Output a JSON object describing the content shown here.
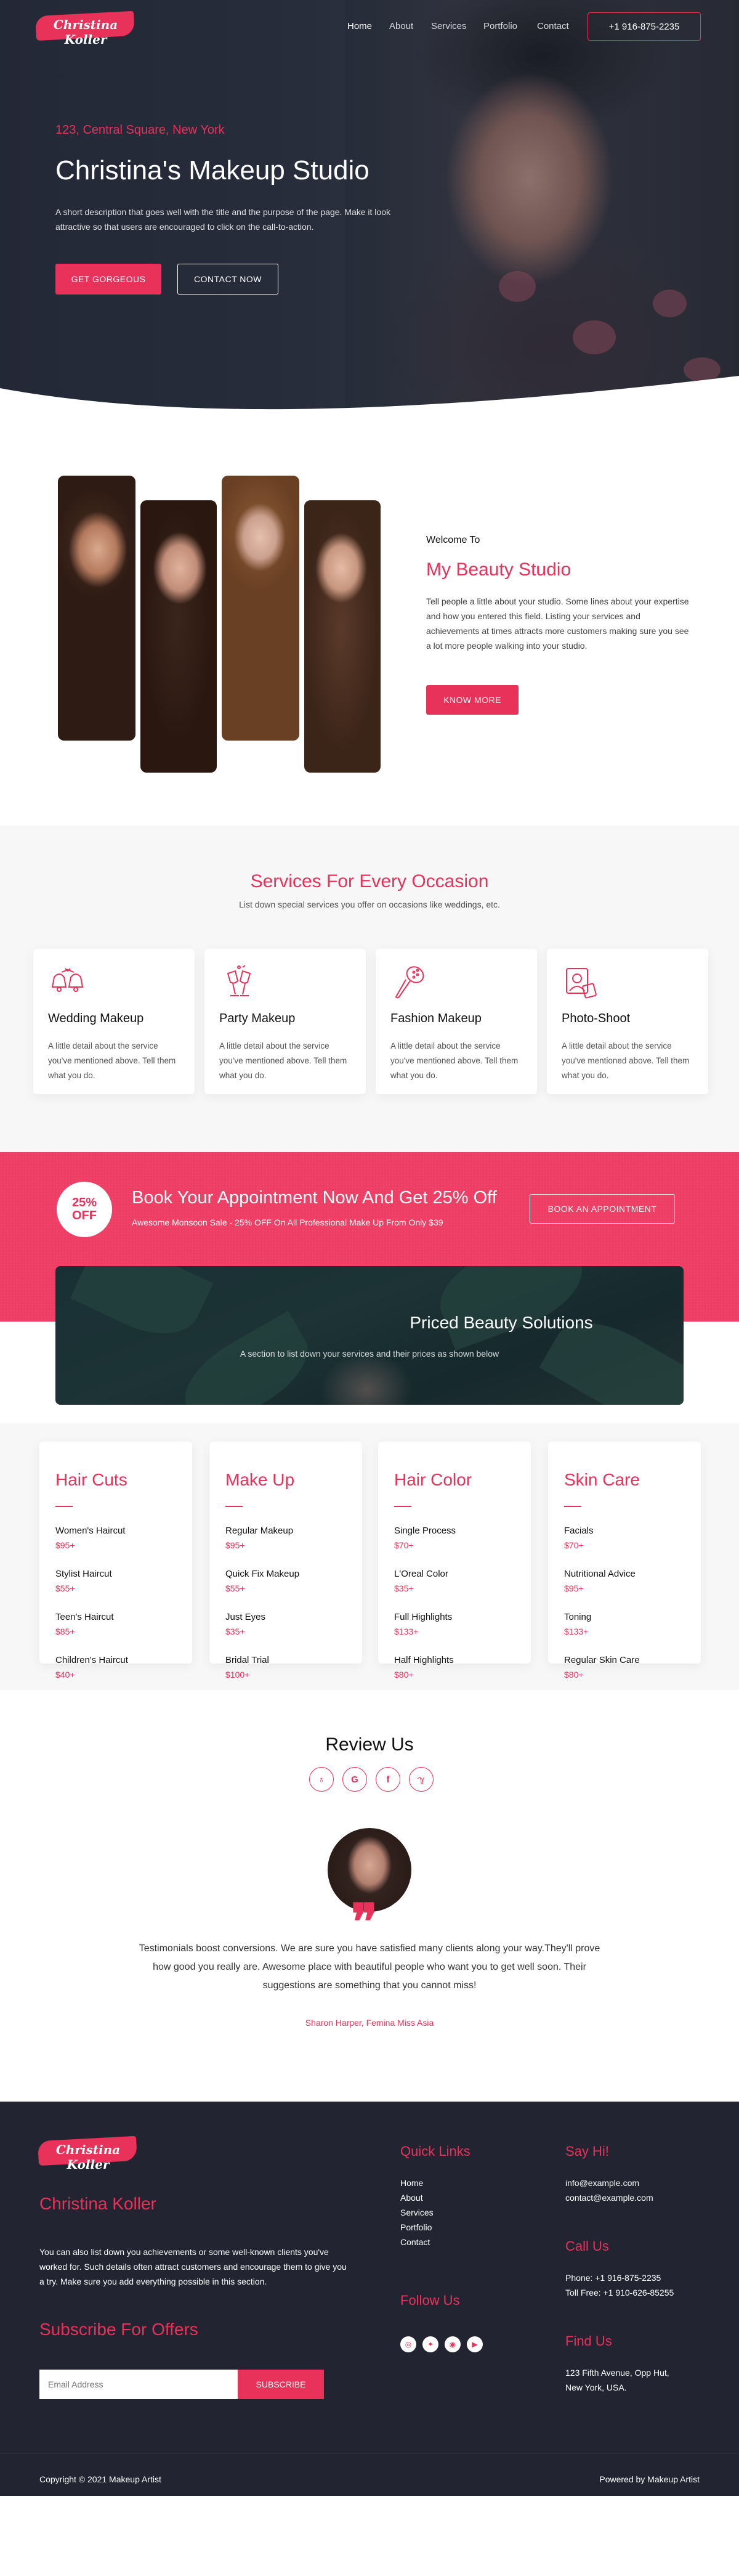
{
  "brand": {
    "name": "Christina Koller",
    "accent": "#e8325a",
    "dark": "#222431"
  },
  "nav": {
    "items": [
      "Home",
      "About",
      "Services",
      "Portfolio",
      "Contact"
    ],
    "phone": "+1 916-875-2235"
  },
  "hero": {
    "address": "123, Central Square, New York",
    "title": "Christina's Makeup Studio",
    "description": "A short description that goes well with the title and the purpose of the page. Make it look attractive so that users are encouraged to click on the call-to-action.",
    "primary_button": "GET GORGEOUS",
    "secondary_button": "CONTACT NOW"
  },
  "about": {
    "welcome": "Welcome To",
    "title": "My Beauty Studio",
    "text": "Tell people a little about your studio. Some lines about your expertise and how you entered this field. Listing your services and achievements at times attracts more customers making sure you see a lot more people walking into your studio.",
    "button": "KNOW MORE"
  },
  "services": {
    "title": "Services For Every Occasion",
    "subtitle": "List down special services you offer on occasions like weddings, etc.",
    "cards": [
      {
        "icon": "wedding-bells-icon",
        "title": "Wedding Makeup",
        "text": "A little detail about the service you've mentioned above. Tell them what you do."
      },
      {
        "icon": "champagne-glasses-icon",
        "title": "Party Makeup",
        "text": "A little detail about the service you've mentioned above. Tell them what you do."
      },
      {
        "icon": "hairbrush-icon",
        "title": "Fashion Makeup",
        "text": "A little detail about the service you've mentioned above. Tell them what you do."
      },
      {
        "icon": "photo-portrait-icon",
        "title": "Photo-Shoot",
        "text": "A little detail about the service you've mentioned above. Tell them what you do."
      }
    ]
  },
  "booking": {
    "badge_top": "25%",
    "badge_bottom": "OFF",
    "title": "Book Your Appointment Now And Get 25% Off",
    "offer": "Awesome Monsoon Sale - 25% OFF On All Professional Make Up From Only $39",
    "button": "BOOK AN APPOINTMENT"
  },
  "pricing": {
    "title": "Priced Beauty Solutions",
    "subtitle": "A section to list down your services and their prices as shown below",
    "categories": [
      {
        "title": "Hair Cuts",
        "items": [
          {
            "name": "Women's Haircut",
            "price": "$95+"
          },
          {
            "name": "Stylist Haircut",
            "price": "$55+"
          },
          {
            "name": "Teen's Haircut",
            "price": "$85+"
          },
          {
            "name": "Children's Haircut",
            "price": "$40+"
          }
        ]
      },
      {
        "title": "Make Up",
        "items": [
          {
            "name": "Regular Makeup",
            "price": "$95+"
          },
          {
            "name": "Quick Fix Makeup",
            "price": "$55+"
          },
          {
            "name": "Just Eyes",
            "price": "$35+"
          },
          {
            "name": "Bridal Trial",
            "price": "$100+"
          }
        ]
      },
      {
        "title": "Hair Color",
        "items": [
          {
            "name": "Single Process",
            "price": "$70+"
          },
          {
            "name": "L'Oreal Color",
            "price": "$35+"
          },
          {
            "name": "Full Highlights",
            "price": "$133+"
          },
          {
            "name": "Half Highlights",
            "price": "$80+"
          }
        ]
      },
      {
        "title": "Skin Care",
        "items": [
          {
            "name": "Facials",
            "price": "$70+"
          },
          {
            "name": "Nutritional Advice",
            "price": "$95+"
          },
          {
            "name": "Toning",
            "price": "$133+"
          },
          {
            "name": "Regular Skin Care",
            "price": "$80+"
          }
        ]
      }
    ]
  },
  "review": {
    "title": "Review Us",
    "icons": [
      "tripadvisor-icon",
      "google-icon",
      "facebook-icon",
      "yelp-icon"
    ],
    "icon_glyphs": [
      "♁",
      "G",
      "f",
      "ℽ"
    ],
    "quote_mark": "❞",
    "text": "Testimonials boost conversions. We are sure you have satisfied many clients along your way.They'll prove how good you really are. Awesome place with beautiful people who want you to get well soon. Their suggestions are something that you cannot miss!",
    "author": "Sharon Harper, Femina Miss Asia"
  },
  "footer": {
    "name": "Christina Koller",
    "about": "You can also list down you achievements or some well-known clients you've worked for. Such details often attract customers and encourage them to give you a try. Make sure you add everything possible in this section.",
    "subscribe_title": "Subscribe For Offers",
    "email_placeholder": "Email Address",
    "subscribe_button": "SUBSCRIBE",
    "quick_links_title": "Quick Links",
    "quick_links": [
      "Home",
      "About",
      "Services",
      "Portfolio",
      "Contact"
    ],
    "follow_title": "Follow Us",
    "follow_icons": [
      "instagram-icon",
      "twitter-icon",
      "instagram-alt-icon",
      "youtube-icon"
    ],
    "follow_glyphs": [
      "◎",
      "✦",
      "◉",
      "▶"
    ],
    "say_hi_title": "Say Hi!",
    "emails": [
      "info@example.com",
      "contact@example.com"
    ],
    "call_title": "Call Us",
    "phones": [
      "Phone: +1 916-875-2235",
      "Toll Free: +1 910-626-85255"
    ],
    "find_title": "Find Us",
    "address_line1": "123 Fifth Avenue, Opp Hut,",
    "address_line2": "New York, USA.",
    "copyright": "Copyright © 2021 Makeup Artist",
    "powered": "Powered by Makeup Artist"
  }
}
